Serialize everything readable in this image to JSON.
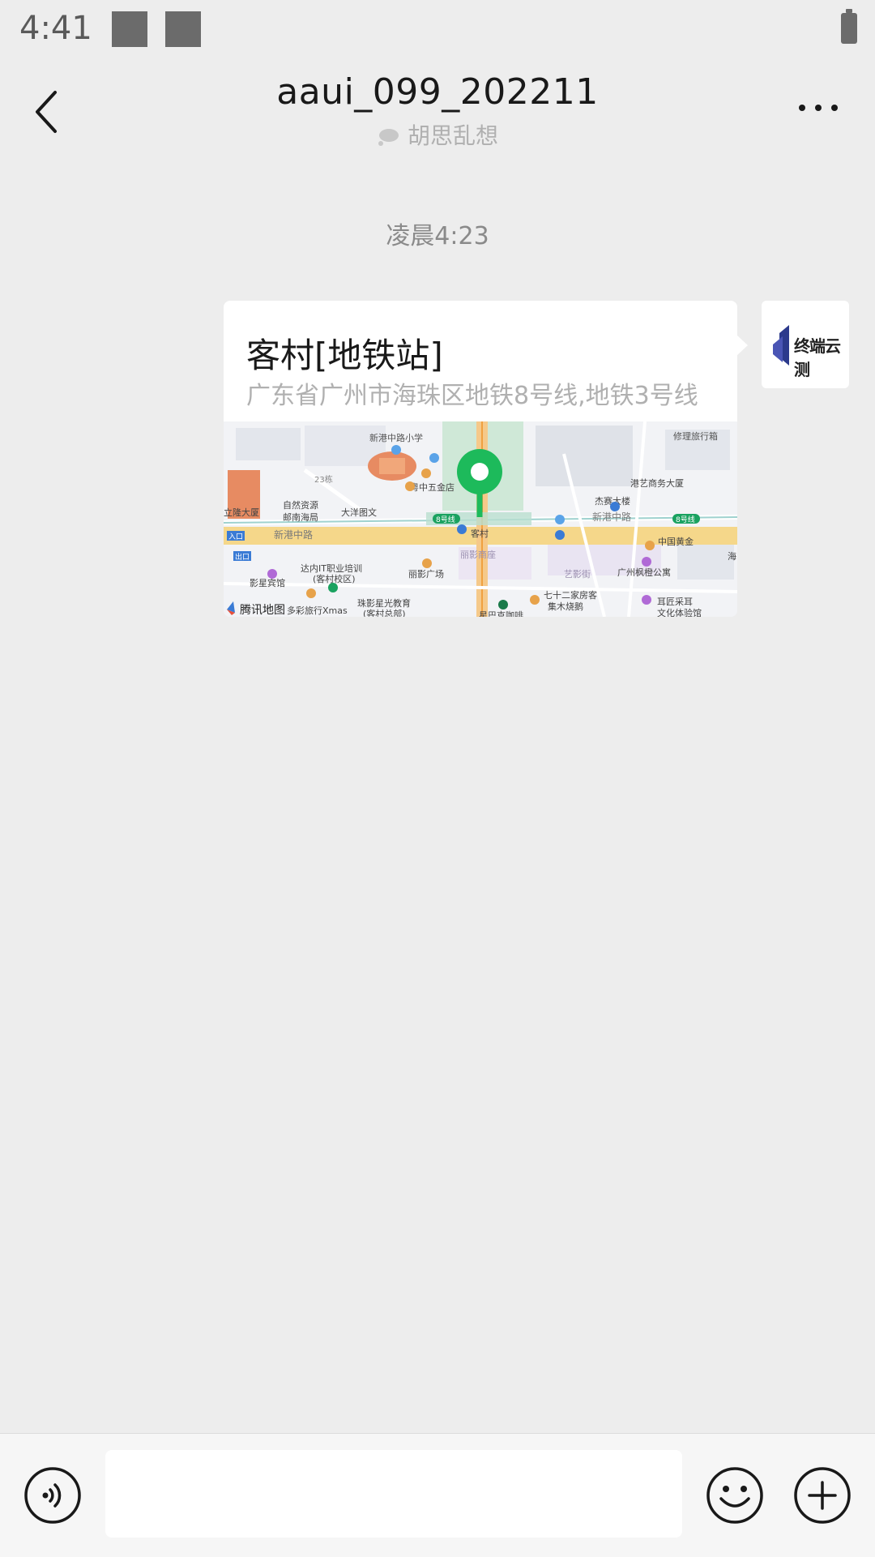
{
  "status_bar": {
    "time": "4:41"
  },
  "header": {
    "title": "aaui_099_202211",
    "subtitle": "胡思乱想",
    "back_icon": "chevron-left-icon",
    "more_icon": "more-dots-icon"
  },
  "chat": {
    "timestamp": "凌晨4:23",
    "location_message": {
      "name": "客村[地铁站]",
      "address": "广东省广州市海珠区地铁8号线,地铁3号线",
      "map_labels": {
        "school": "新港中路小学",
        "travel_agency": "修理旅行箱",
        "building_23": "23栋",
        "hotel": "粤中五金店",
        "gangyi": "港艺商务大厦",
        "jiesai": "杰赛大楼",
        "ziran": "自然资源",
        "youzheng": "邮南海局",
        "dayang": "大洋图文",
        "lilong": "立隆大厦",
        "xingang_w": "新港中路",
        "xingang_e": "新港中路",
        "line8_a": "8号线",
        "line8_b": "8号线",
        "kecun": "客村",
        "exit_a": "入口",
        "exit_b": "出口",
        "zhongguo": "中国黄金",
        "it": "达内IT职业培训",
        "it2": "(客村校区)",
        "lihong": "丽影广场",
        "lihong2": "丽影商座",
        "yixing": "艺影街",
        "fengyi": "广州枫橙公寓",
        "yingxing": "影星宾馆",
        "xmas": "多彩旅行Xmas",
        "zhuying": "珠影星光教育",
        "zhuying2": "(客村总部)",
        "qishier": "七十二家房客",
        "jimu": "集木烧鹅",
        "huijiang": "耳匠采耳",
        "wenhua": "文化体验馆",
        "xingba": "星巴克咖啡",
        "brand": "腾讯地图",
        "haixia": "海"
      }
    },
    "avatar_label": "终端云测"
  },
  "input_bar": {
    "placeholder": "",
    "voice_icon": "voice-icon",
    "emoji_icon": "emoji-icon",
    "plus_icon": "plus-icon"
  },
  "colors": {
    "background": "#ededed",
    "pin": "#1dba5b",
    "road": "#f5d78a"
  }
}
